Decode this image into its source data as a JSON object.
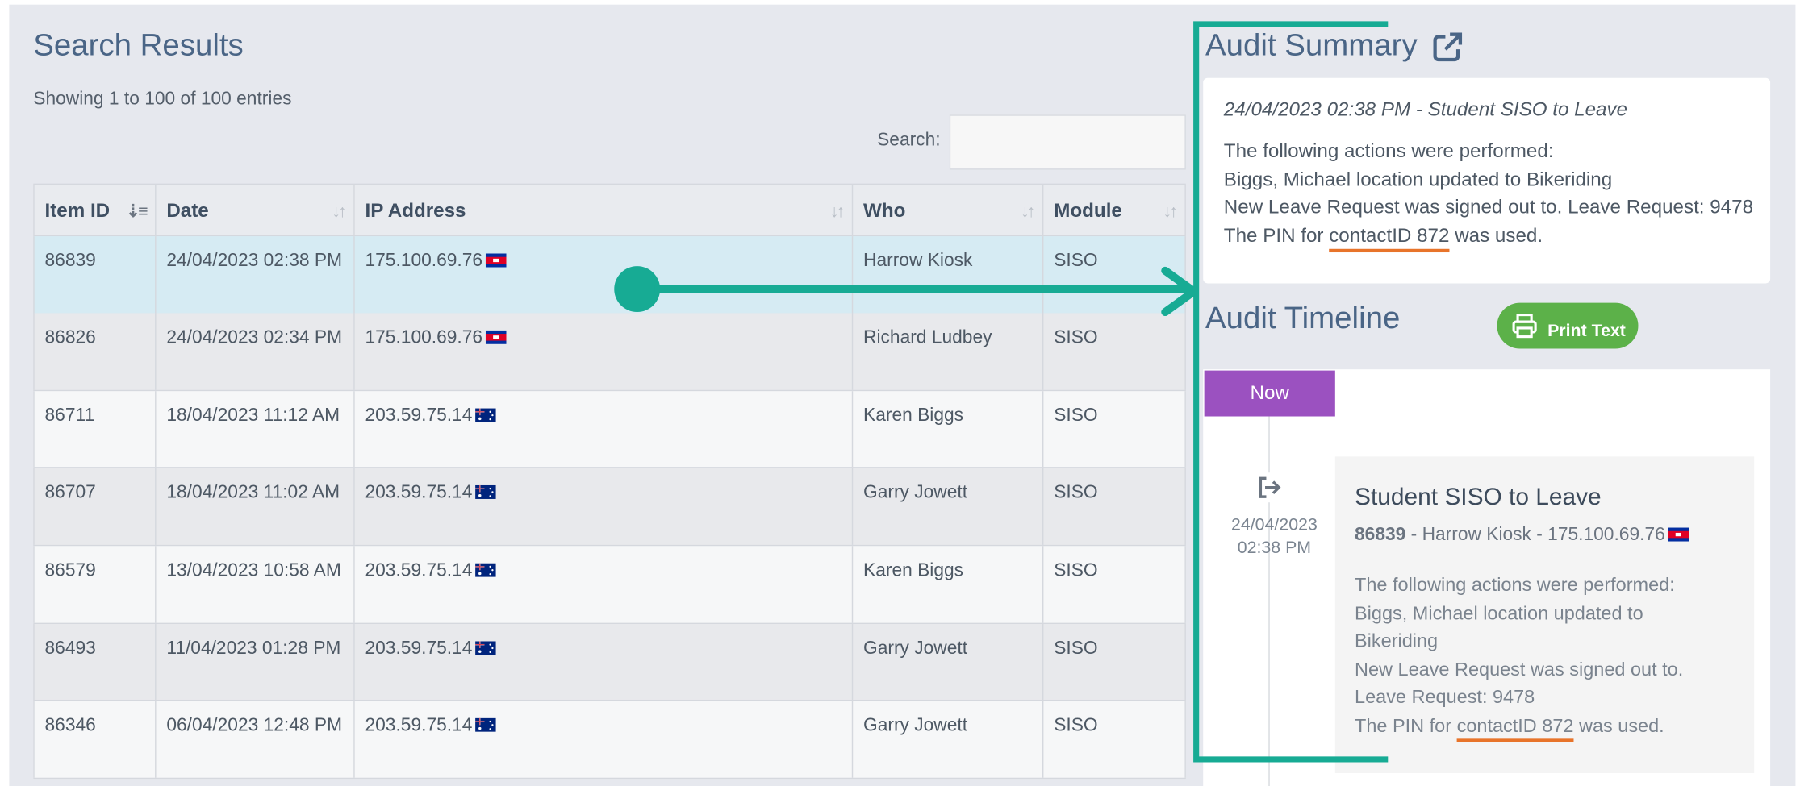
{
  "search_results": {
    "title": "Search Results",
    "showing": "Showing 1 to 100 of 100 entries",
    "search_label": "Search:",
    "search_value": "",
    "columns": [
      {
        "label": "Item ID"
      },
      {
        "label": "Date"
      },
      {
        "label": "IP Address"
      },
      {
        "label": "Who"
      },
      {
        "label": "Module"
      }
    ],
    "rows": [
      {
        "id": "86839",
        "date": "24/04/2023 02:38 PM",
        "ip": "175.100.69.76",
        "flag": "kh",
        "who": "Harrow Kiosk",
        "module": "SISO",
        "selected": true
      },
      {
        "id": "86826",
        "date": "24/04/2023 02:34 PM",
        "ip": "175.100.69.76",
        "flag": "kh",
        "who": "Richard Ludbey",
        "module": "SISO"
      },
      {
        "id": "86711",
        "date": "18/04/2023 11:12 AM",
        "ip": "203.59.75.14",
        "flag": "au",
        "who": "Karen Biggs",
        "module": "SISO"
      },
      {
        "id": "86707",
        "date": "18/04/2023 11:02 AM",
        "ip": "203.59.75.14",
        "flag": "au",
        "who": "Garry Jowett",
        "module": "SISO"
      },
      {
        "id": "86579",
        "date": "13/04/2023 10:58 AM",
        "ip": "203.59.75.14",
        "flag": "au",
        "who": "Karen Biggs",
        "module": "SISO"
      },
      {
        "id": "86493",
        "date": "11/04/2023 01:28 PM",
        "ip": "203.59.75.14",
        "flag": "au",
        "who": "Garry Jowett",
        "module": "SISO"
      },
      {
        "id": "86346",
        "date": "06/04/2023 12:48 PM",
        "ip": "203.59.75.14",
        "flag": "au",
        "who": "Garry Jowett",
        "module": "SISO"
      }
    ]
  },
  "audit_summary": {
    "title": "Audit Summary",
    "heading": "24/04/2023 02:38 PM - Student SISO to Leave",
    "line1": "The following actions were performed:",
    "line2": "Biggs, Michael location updated to Bikeriding",
    "line3": "New Leave Request was signed out to. Leave Request: 9478",
    "pin_before": "The PIN for ",
    "pin_contact": "contactID 872",
    "pin_after": " was used."
  },
  "audit_timeline": {
    "title": "Audit Timeline",
    "print_label": "Print Text",
    "now_label": "Now",
    "entry": {
      "date_line1": "24/04/2023",
      "date_line2": "02:38 PM",
      "title": "Student SISO to Leave",
      "item_id": "86839",
      "meta_rest": " - Harrow Kiosk - 175.100.69.76",
      "line1": "The following actions were performed:",
      "line2a": "Biggs, Michael location updated to",
      "line2b": "Bikeriding",
      "line3a": "New Leave Request was signed out to.",
      "line3b": "Leave Request: 9478",
      "pin_before": "The PIN for ",
      "pin_contact": "contactID 872",
      "pin_after": " was used."
    }
  },
  "colors": {
    "annotation": "#17ab94",
    "underline": "#e8742a",
    "now_badge": "#9b51c0",
    "print_button": "#5cb149",
    "selected_row": "#d6ebf3"
  },
  "icons": {
    "external_link": "external-link-icon",
    "printer": "printer-icon",
    "sign_out": "sign-out-icon",
    "sort": "sort-icon"
  }
}
